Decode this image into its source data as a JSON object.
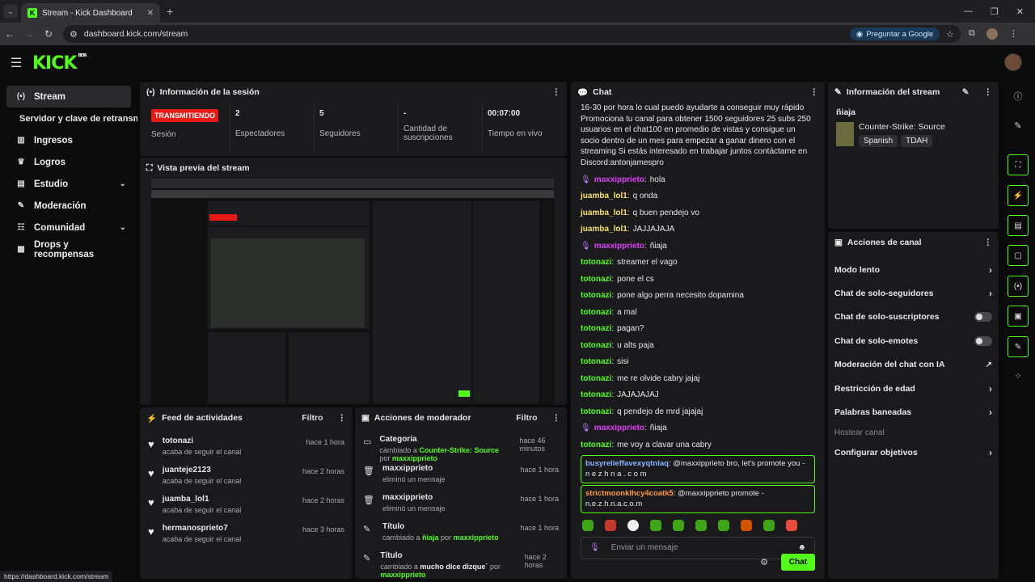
{
  "browser": {
    "tab_title": "Stream - Kick Dashboard",
    "url": "dashboard.kick.com/stream",
    "ask_google": "Preguntar a Google",
    "status_url": "https://dashboard.kick.com/stream"
  },
  "header": {
    "logo": "KICK",
    "beta": "BETA"
  },
  "sidebar": {
    "items": [
      {
        "label": "Stream",
        "icon": "broadcast-icon"
      },
      {
        "label": "Servidor y clave de retransmisión"
      },
      {
        "label": "Ingresos",
        "icon": "chart-icon"
      },
      {
        "label": "Logros",
        "icon": "trophy-icon"
      },
      {
        "label": "Estudio",
        "icon": "studio-icon"
      },
      {
        "label": "Moderación",
        "icon": "wrench-icon"
      },
      {
        "label": "Comunidad",
        "icon": "users-icon"
      },
      {
        "label": "Drops y recompensas",
        "icon": "drops-icon"
      }
    ]
  },
  "session": {
    "title": "Información de la sesión",
    "live_badge": "TRANSMITIENDO",
    "stats": [
      {
        "value": "",
        "label": "Sesión"
      },
      {
        "value": "2",
        "label": "Espectadores"
      },
      {
        "value": "5",
        "label": "Seguidores"
      },
      {
        "value": "-",
        "label": "Cantidad de suscripciones"
      },
      {
        "value": "00:07:00",
        "label": "Tiempo en vivo"
      }
    ]
  },
  "preview": {
    "title": "Vista previa del stream"
  },
  "activity": {
    "title": "Feed de actividades",
    "filter": "Filtro",
    "rows": [
      {
        "name": "totonazi",
        "desc": "acaba de seguir el canal",
        "time": "hace 1 hora"
      },
      {
        "name": "juanteje2123",
        "desc": "acaba de seguir el canal",
        "time": "hace 2 horas"
      },
      {
        "name": "juamba_lol1",
        "desc": "acaba de seguir el canal",
        "time": "hace 2 horas"
      },
      {
        "name": "hermanosprieto7",
        "desc": "acaba de seguir el canal",
        "time": "hace 3 horas"
      }
    ]
  },
  "mod_actions": {
    "title": "Acciones de moderador",
    "filter": "Filtro",
    "rows": [
      {
        "name": "Categoría",
        "pre": "cambiado a ",
        "hl": "Counter-Strike: Source",
        "mid": " por ",
        "by": "maxxipprieto",
        "time": "hace 46 minutos"
      },
      {
        "name": "maxxipprieto",
        "pre": "eliminó un mensaje",
        "hl": "",
        "mid": "",
        "by": "",
        "time": "hace 1 hora"
      },
      {
        "name": "maxxipprieto",
        "pre": "eliminó un mensaje",
        "hl": "",
        "mid": "",
        "by": "",
        "time": "hace 1 hora"
      },
      {
        "name": "Título",
        "pre": "cambiado a ",
        "hl": "ñiaja",
        "mid": " por ",
        "by": "maxxipprieto",
        "time": "hace 1 hora"
      },
      {
        "name": "Título",
        "pre": "cambiado a ",
        "hl": "mucho dice dizque`",
        "mid": " por ",
        "by": "maxxipprieto",
        "time": "hace 2 horas"
      }
    ]
  },
  "chat": {
    "title": "Chat",
    "promo": "16-30 por hora lo cual puedo ayudarte a conseguir muy rápido Promociona tu canal para obtener 1500 seguidores 25 subs 250 usuarios en el chat100 en promedio de vistas y consigue un socio dentro de un mes para empezar a ganar dinero con el streaming Si estás interesado en trabajar juntos contáctame en Discord:antonjamespro",
    "messages": [
      {
        "user": "maxxipprieto",
        "text": "hola",
        "style": "p"
      },
      {
        "user": "juamba_lol1",
        "text": "q onda",
        "style": "y"
      },
      {
        "user": "juamba_lol1",
        "text": "q buen pendejo vo",
        "style": "y"
      },
      {
        "user": "juamba_lol1",
        "text": "JAJJAJAJA",
        "style": "y"
      },
      {
        "user": "maxxipprieto",
        "text": "ñiaja",
        "style": "p"
      },
      {
        "user": "totonazi",
        "text": "streamer el vago",
        "style": "g"
      },
      {
        "user": "totonazi",
        "text": "pone el cs",
        "style": "g"
      },
      {
        "user": "totonazi",
        "text": "pone algo perra necesito dopamina",
        "style": "g"
      },
      {
        "user": "totonazi",
        "text": "a mal",
        "style": "g"
      },
      {
        "user": "totonazi",
        "text": "pagan?",
        "style": "g"
      },
      {
        "user": "totonazi",
        "text": "u alts paja",
        "style": "g"
      },
      {
        "user": "totonazi",
        "text": "sisi",
        "style": "g"
      },
      {
        "user": "totonazi",
        "text": "me re olvide cabry jajaj",
        "style": "g"
      },
      {
        "user": "totonazi",
        "text": "JAJAJAJAJ",
        "style": "g"
      },
      {
        "user": "totonazi",
        "text": "q pendejo de mrd jajajaj",
        "style": "g"
      },
      {
        "user": "maxxipprieto",
        "text": "ñiaja",
        "style": "p"
      },
      {
        "user": "totonazi",
        "text": "me voy a clavar una cabry",
        "style": "g"
      }
    ],
    "highlight1": {
      "user": "busyrelieffavexyqtnlaq",
      "text": "@maxxipprieto bro, let's promote you - n e z h n a . c o m"
    },
    "highlight2": {
      "user": "strictmoonklhcy4coatk5",
      "text": "@maxxipprieto promote - n.e.z.h.n.a.c.o.m"
    },
    "placeholder": "Enviar un mensaje",
    "send": "Chat"
  },
  "stream_info": {
    "title": "Información del stream",
    "stream_title": "ñiaja",
    "game": "Counter-Strike: Source",
    "tags": [
      "Spanish",
      "TDAH"
    ]
  },
  "channel_actions": {
    "title": "Acciones de canal",
    "items": [
      {
        "label": "Modo lento",
        "type": "chevron"
      },
      {
        "label": "Chat de solo-seguidores",
        "type": "chevron"
      },
      {
        "label": "Chat de solo-suscriptores",
        "type": "toggle"
      },
      {
        "label": "Chat de solo-emotes",
        "type": "toggle"
      },
      {
        "label": "Moderación del chat con IA",
        "type": "external"
      },
      {
        "label": "Restricción de edad",
        "type": "chevron"
      },
      {
        "label": "Palabras baneadas",
        "type": "chevron"
      },
      {
        "label": "Hostear canal",
        "type": "disabled"
      },
      {
        "label": "Configurar objetivos",
        "type": "chevron"
      }
    ]
  }
}
